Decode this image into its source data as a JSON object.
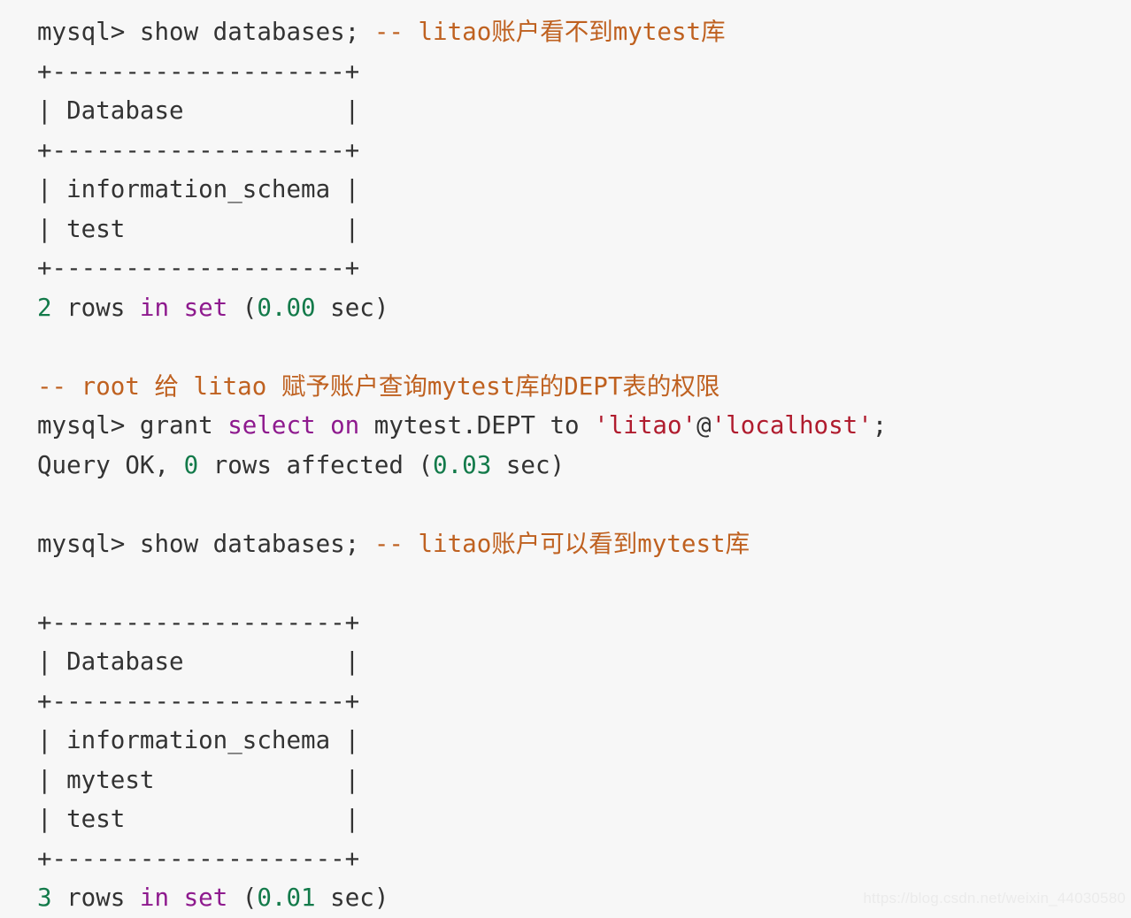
{
  "page": {
    "background_color": "#f7f7f7",
    "default_text_color": "#333333"
  },
  "palette": {
    "comment": "#bf6120",
    "keyword": "#8e1a8e",
    "number": "#137a4a",
    "identifier": "#1565c0",
    "string": "#b01c2e",
    "watermark": "#ebebeb"
  },
  "watermark": {
    "text": "https://blog.csdn.net/weixin_44030580"
  },
  "terminal": {
    "lines": [
      {
        "id": "line-1-show-databases-restricted",
        "tokens": [
          {
            "t": "mysql> show databases; ",
            "c": "default"
          },
          {
            "t": "-- litao账户看不到mytest库",
            "c": "comment"
          }
        ]
      },
      {
        "id": "line-2-table1-top-border",
        "tokens": [
          {
            "t": "+--------------------+",
            "c": "default"
          }
        ]
      },
      {
        "id": "line-3-table1-header",
        "tokens": [
          {
            "t": "| Database           |",
            "c": "default"
          }
        ]
      },
      {
        "id": "line-4-table1-header-sep",
        "tokens": [
          {
            "t": "+--------------------+",
            "c": "default"
          }
        ]
      },
      {
        "id": "line-5-table1-row-information-schema",
        "tokens": [
          {
            "t": "| information_schema |",
            "c": "default"
          }
        ]
      },
      {
        "id": "line-6-table1-row-test",
        "tokens": [
          {
            "t": "| test               |",
            "c": "default"
          }
        ]
      },
      {
        "id": "line-7-table1-bottom-border",
        "tokens": [
          {
            "t": "+--------------------+",
            "c": "default"
          }
        ]
      },
      {
        "id": "line-8-table1-rowcount",
        "tokens": [
          {
            "t": "2",
            "c": "number"
          },
          {
            "t": " rows ",
            "c": "default"
          },
          {
            "t": "in set",
            "c": "keyword"
          },
          {
            "t": " (",
            "c": "default"
          },
          {
            "t": "0.00",
            "c": "number"
          },
          {
            "t": " sec)",
            "c": "default"
          }
        ]
      },
      {
        "id": "line-9-blank",
        "blank": true,
        "tokens": []
      },
      {
        "id": "line-10-comment-grant-intent",
        "tokens": [
          {
            "t": "-- root 给 litao 赋予账户查询mytest库的DEPT表的权限",
            "c": "comment"
          }
        ]
      },
      {
        "id": "line-11-grant-statement",
        "tokens": [
          {
            "t": "mysql> grant ",
            "c": "default"
          },
          {
            "t": "select on",
            "c": "keyword"
          },
          {
            "t": " mytest.",
            "c": "default"
          },
          {
            "t": "DEPT",
            "c": "identifier"
          },
          {
            "t": " to ",
            "c": "default"
          },
          {
            "t": "'litao'",
            "c": "string"
          },
          {
            "t": "@",
            "c": "default"
          },
          {
            "t": "'localhost'",
            "c": "string"
          },
          {
            "t": ";",
            "c": "default"
          }
        ]
      },
      {
        "id": "line-12-query-ok",
        "tokens": [
          {
            "t": "Query OK, ",
            "c": "default"
          },
          {
            "t": "0",
            "c": "number"
          },
          {
            "t": " rows affected (",
            "c": "default"
          },
          {
            "t": "0.03",
            "c": "number"
          },
          {
            "t": " sec)",
            "c": "default"
          }
        ]
      },
      {
        "id": "line-13-blank",
        "blank": true,
        "tokens": []
      },
      {
        "id": "line-14-show-databases-granted",
        "tokens": [
          {
            "t": "mysql> show databases; ",
            "c": "default"
          },
          {
            "t": "-- litao账户可以看到mytest库",
            "c": "comment"
          }
        ]
      },
      {
        "id": "line-15-blank",
        "blank": true,
        "tokens": []
      },
      {
        "id": "line-16-table2-top-border",
        "tokens": [
          {
            "t": "+--------------------+",
            "c": "default"
          }
        ]
      },
      {
        "id": "line-17-table2-header",
        "tokens": [
          {
            "t": "| Database           |",
            "c": "default"
          }
        ]
      },
      {
        "id": "line-18-table2-header-sep",
        "tokens": [
          {
            "t": "+--------------------+",
            "c": "default"
          }
        ]
      },
      {
        "id": "line-19-table2-row-information-schema",
        "tokens": [
          {
            "t": "| information_schema |",
            "c": "default"
          }
        ]
      },
      {
        "id": "line-20-table2-row-mytest",
        "tokens": [
          {
            "t": "| mytest             |",
            "c": "default"
          }
        ]
      },
      {
        "id": "line-21-table2-row-test",
        "tokens": [
          {
            "t": "| test               |",
            "c": "default"
          }
        ]
      },
      {
        "id": "line-22-table2-bottom-border",
        "tokens": [
          {
            "t": "+--------------------+",
            "c": "default"
          }
        ]
      },
      {
        "id": "line-23-table2-rowcount",
        "tokens": [
          {
            "t": "3",
            "c": "number"
          },
          {
            "t": " rows ",
            "c": "default"
          },
          {
            "t": "in set",
            "c": "keyword"
          },
          {
            "t": " (",
            "c": "default"
          },
          {
            "t": "0.01",
            "c": "number"
          },
          {
            "t": " sec)",
            "c": "default"
          }
        ]
      }
    ]
  }
}
